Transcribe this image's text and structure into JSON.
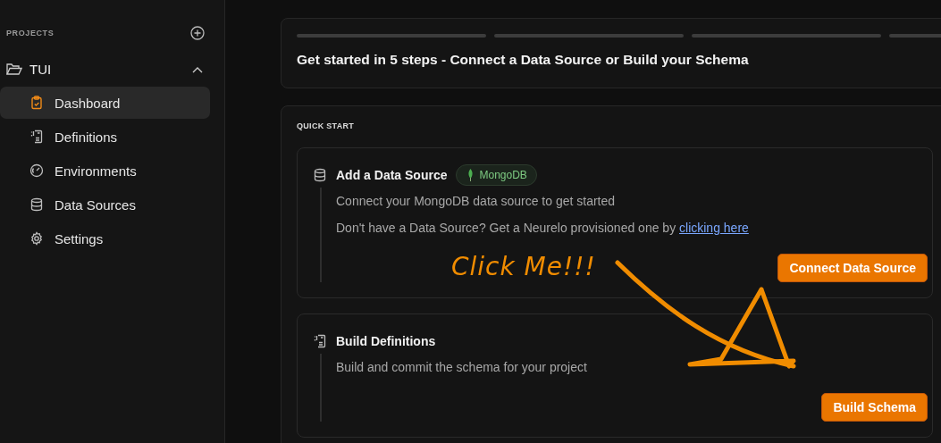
{
  "sidebar": {
    "heading": "PROJECTS",
    "project": {
      "name": "TUI",
      "expanded": true
    },
    "items": [
      {
        "label": "Dashboard",
        "kind": "clipboard",
        "selected": true
      },
      {
        "label": "Definitions",
        "kind": "definitions",
        "selected": false
      },
      {
        "label": "Environments",
        "kind": "gauge",
        "selected": false
      },
      {
        "label": "Data Sources",
        "kind": "database",
        "selected": false
      },
      {
        "label": "Settings",
        "kind": "gear",
        "selected": false
      }
    ]
  },
  "steps_card": {
    "steps": [
      {
        "done": false
      },
      {
        "done": false
      },
      {
        "done": false
      },
      {
        "done": false
      }
    ],
    "title": "Get started in 5 steps - Connect a Data Source or Build your Schema"
  },
  "quick_start": {
    "heading": "QUICK START",
    "cards": [
      {
        "kind": "database",
        "title": "Add a Data Source",
        "badge": "MongoDB",
        "lines": [
          {
            "text": "Connect your MongoDB data source to get started"
          },
          {
            "text": "Don't have a Data Source? Get a Neurelo provisioned one by ",
            "link": "clicking here"
          }
        ],
        "button": "Connect Data Source"
      },
      {
        "kind": "definitions",
        "title": "Build Definitions",
        "lines": [
          {
            "text": "Build and commit the schema for your project"
          }
        ],
        "button": "Build Schema"
      }
    ]
  },
  "annotation": {
    "text": "Click Me!!!"
  }
}
